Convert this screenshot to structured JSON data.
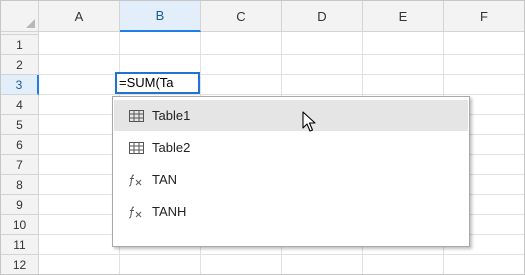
{
  "columns": [
    "A",
    "B",
    "C",
    "D",
    "E",
    "F"
  ],
  "selected_column": "B",
  "rows": [
    "1",
    "2",
    "3",
    "4",
    "5",
    "6",
    "7",
    "8",
    "9",
    "10",
    "11",
    "12"
  ],
  "selected_row": "3",
  "active_cell": {
    "ref": "B3",
    "formula": "=SUM(Ta"
  },
  "autocomplete": {
    "items": [
      {
        "label": "Table1",
        "icon": "table-icon",
        "highlighted": true
      },
      {
        "label": "Table2",
        "icon": "table-icon",
        "highlighted": false
      },
      {
        "label": "TAN",
        "icon": "function-icon",
        "highlighted": false
      },
      {
        "label": "TANH",
        "icon": "function-icon",
        "highlighted": false
      }
    ]
  },
  "colors": {
    "accent": "#217ee6",
    "header_bg": "#f3f3f3",
    "selected_header_bg": "#e2eef9",
    "highlight_bg": "#e5e5e5"
  }
}
